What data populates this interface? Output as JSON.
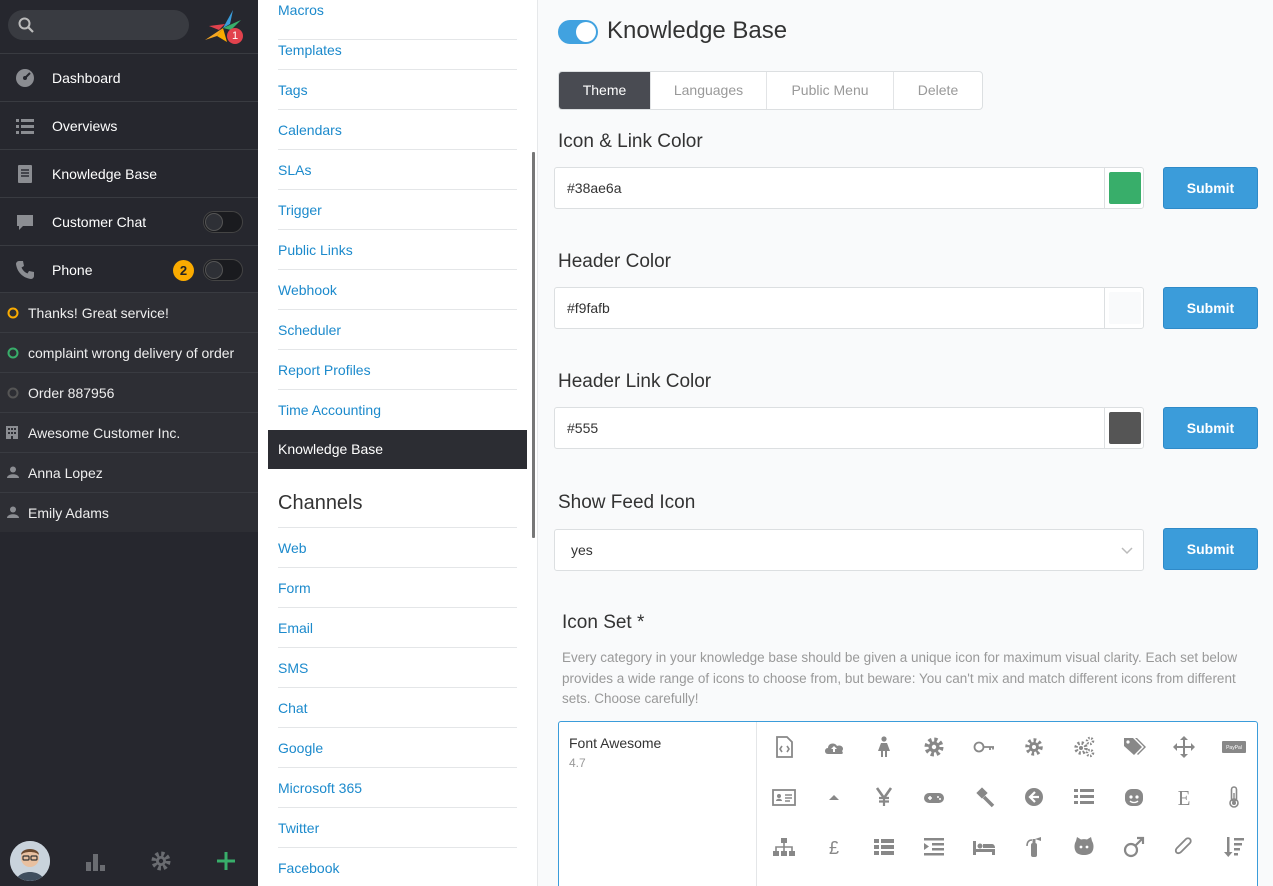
{
  "sidebar": {
    "search": {
      "placeholder": ""
    },
    "notification_count": "1",
    "nav": [
      {
        "label": "Dashboard",
        "icon": "dashboard-icon"
      },
      {
        "label": "Overviews",
        "icon": "list-icon"
      },
      {
        "label": "Knowledge Base",
        "icon": "book-icon"
      },
      {
        "label": "Customer Chat",
        "icon": "chat-icon",
        "toggle": false
      },
      {
        "label": "Phone",
        "icon": "phone-icon",
        "badge": "2",
        "toggle": false
      }
    ],
    "tasks": [
      {
        "label": "Thanks! Great service!",
        "icon": "ticket-open-icon",
        "color": "#faab00"
      },
      {
        "label": "complaint wrong delivery of order",
        "icon": "ticket-new-icon",
        "color": "#38ae6a"
      },
      {
        "label": "Order 887956",
        "icon": "ticket-closed-icon",
        "color": "#888888"
      },
      {
        "label": "Awesome Customer Inc.",
        "icon": "organization-icon"
      },
      {
        "label": "Anna Lopez",
        "icon": "user-icon"
      },
      {
        "label": "Emily Adams",
        "icon": "user-icon"
      }
    ]
  },
  "settings_menu": {
    "items": [
      "Macros",
      "Templates",
      "Tags",
      "Calendars",
      "SLAs",
      "Trigger",
      "Public Links",
      "Webhook",
      "Scheduler",
      "Report Profiles",
      "Time Accounting"
    ],
    "active": "Knowledge Base",
    "channels_heading": "Channels",
    "channels": [
      "Web",
      "Form",
      "Email",
      "SMS",
      "Chat",
      "Google",
      "Microsoft 365",
      "Twitter",
      "Facebook"
    ]
  },
  "main": {
    "title": "Knowledge Base",
    "enabled": true,
    "tabs": [
      "Theme",
      "Languages",
      "Public Menu",
      "Delete"
    ],
    "active_tab": "Theme",
    "fields": [
      {
        "label": "Icon & Link Color",
        "value": "#38ae6a",
        "swatch": "#38ae6a",
        "submit": "Submit"
      },
      {
        "label": "Header Color",
        "value": "#f9fafb",
        "swatch": "#f9fafb",
        "submit": "Submit"
      },
      {
        "label": "Header Link Color",
        "value": "#555",
        "swatch": "#555555",
        "submit": "Submit"
      }
    ],
    "feed": {
      "label": "Show Feed Icon",
      "value": "yes",
      "submit": "Submit"
    },
    "iconset": {
      "label": "Icon Set *",
      "help": "Every category in your knowledge base should be given a unique icon for maximum visual clarity. Each set below provides a wide range of icons to choose from, but beware: You can't mix and match different icons from different sets. Choose carefully!",
      "name": "Font Awesome",
      "version": "4.7",
      "icons": [
        "file-code-icon",
        "cloud-upload-icon",
        "female-icon",
        "gear-icon",
        "key-icon",
        "cog-icon",
        "cogs-icon",
        "tags-icon",
        "arrows-icon",
        "paypal-icon",
        "id-card-icon",
        "caret-up-icon",
        "yen-icon",
        "gamepad-icon",
        "gavel-icon",
        "arrow-circle-left-icon",
        "list-icon",
        "reddit-icon",
        "etsy-icon",
        "thermometer-icon",
        "sitemap-icon",
        "gbp-icon",
        "th-list-icon",
        "indent-icon",
        "bed-icon",
        "fire-extinguisher-icon",
        "github-icon",
        "mars-icon",
        "paperclip-icon",
        "sort-amount-icon"
      ]
    }
  }
}
